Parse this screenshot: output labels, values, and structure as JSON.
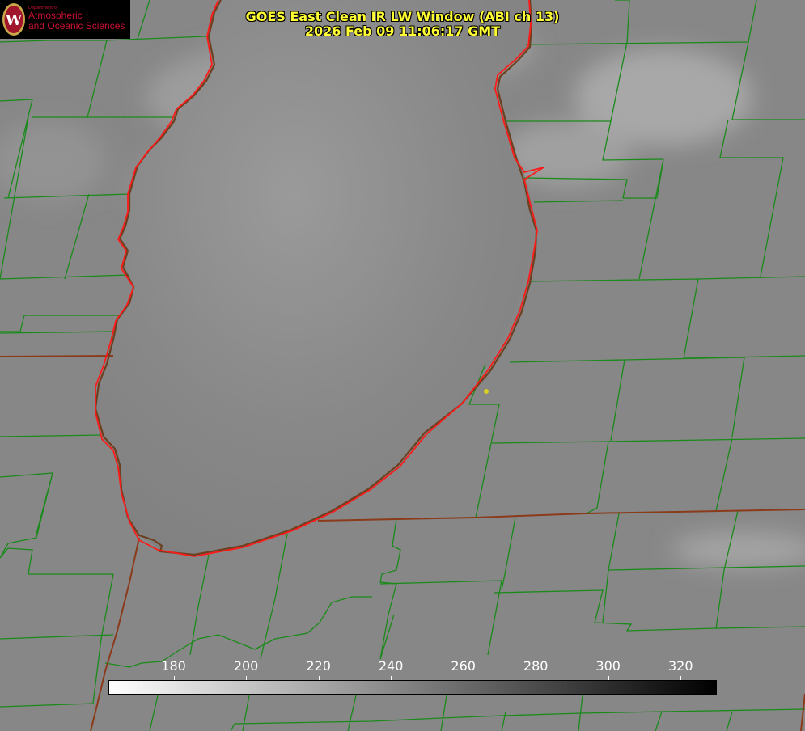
{
  "title": {
    "line1": "GOES East Clean IR LW Window (ABI ch 13)",
    "line2": "2026 Feb 09 11:06:17 GMT",
    "color": "#ffff33"
  },
  "logo": {
    "dept": "Department of",
    "line1": "Atmospheric",
    "line2": "and Oceanic Sciences",
    "text_color": "#cc1133",
    "shield_color": "#a0142c",
    "shield_letter": "W",
    "shield_border": "#c9a64a"
  },
  "colorbar": {
    "ticks": [
      "180",
      "200",
      "220",
      "240",
      "260",
      "280",
      "300",
      "320"
    ],
    "tick_values": [
      180,
      200,
      220,
      240,
      260,
      280,
      300,
      320
    ],
    "min": 162,
    "max": 330,
    "gradient_start": "#ffffff",
    "gradient_end": "#000000",
    "label_color": "#ffffff"
  },
  "map": {
    "lake_outline_color": "#ff1a1a",
    "boundary_color": "#1a8a1a",
    "state_line_color": "#8b3a1a",
    "background": "#8a8a8a",
    "marker_color": "#d8d020"
  }
}
